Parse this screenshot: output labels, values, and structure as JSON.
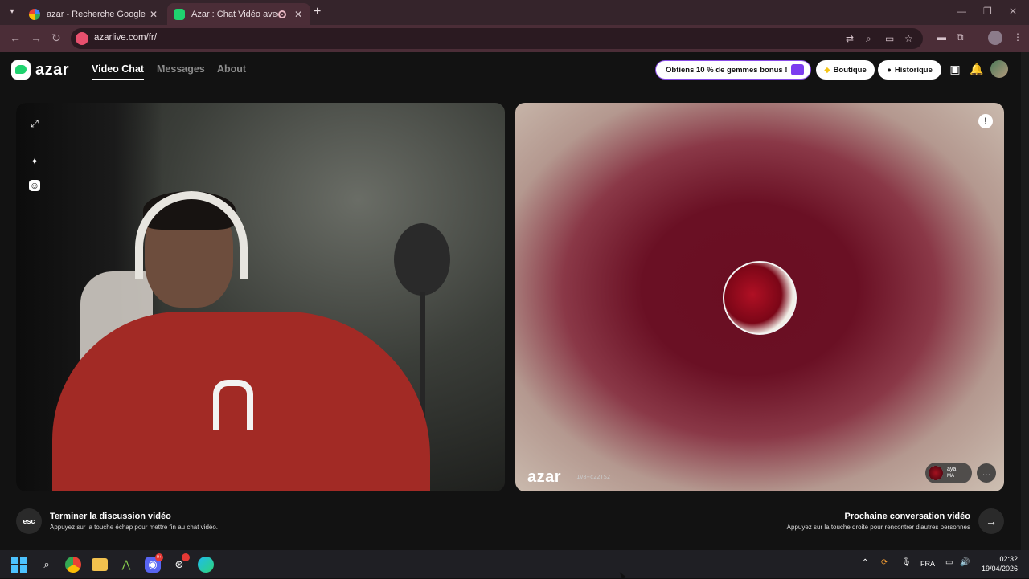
{
  "browser": {
    "tabs": [
      {
        "title": "azar - Recherche Google",
        "active": false
      },
      {
        "title": "Azar : Chat Vidéo avec de n",
        "active": true
      }
    ],
    "url": "azarlive.com/fr/"
  },
  "header": {
    "logo": "azar",
    "nav": [
      "Video Chat",
      "Messages",
      "About"
    ],
    "gems_promo": "Obtiens 10 % de gemmes bonus !",
    "shop": "Boutique",
    "history": "Historique"
  },
  "video": {
    "watermark": "azar",
    "watermark_id": "1v8+c22TS2",
    "peer_name": "aya",
    "peer_country": "MA"
  },
  "footer": {
    "esc_key": "esc",
    "end_title": "Terminer la discussion vidéo",
    "end_subtitle": "Appuyez sur la touche échap pour mettre fin au chat vidéo.",
    "next_title": "Prochaine conversation vidéo",
    "next_subtitle": "Appuyez sur la touche droite pour rencontrer d'autres personnes"
  },
  "taskbar": {
    "language": "FRA",
    "time": "02:32",
    "date": "19/04/2026",
    "notification_badge": "9+"
  },
  "colors": {
    "accent": "#1fd36f",
    "chrome": "#4b2d37",
    "promo_border": "#8a4de8"
  }
}
